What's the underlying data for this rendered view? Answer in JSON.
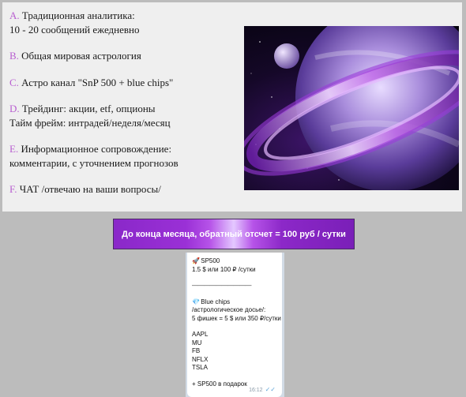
{
  "services": [
    {
      "letter": "A.",
      "lines": [
        "Традиционная аналитика:",
        "10 - 20 сообщений ежедневно"
      ]
    },
    {
      "letter": "B.",
      "lines": [
        "Общая мировая астрология"
      ]
    },
    {
      "letter": "C.",
      "lines": [
        "Астро канал \"SnP 500 + blue chips\""
      ]
    },
    {
      "letter": "D.",
      "lines": [
        "Трейдинг: акции, etf, опционы",
        "Тайм фрейм: интрадей/неделя/месяц"
      ]
    },
    {
      "letter": "E.",
      "lines": [
        "Информационное сопровождение:",
        "комментарии, с уточнением прогнозов"
      ]
    },
    {
      "letter": "F.",
      "lines": [
        "ЧАТ /отвечаю на ваши вопросы/"
      ]
    }
  ],
  "banner": {
    "text": "До конца месяца, обратный отсчет = 100 руб / сутки"
  },
  "chat": {
    "sp500_title": "SP500",
    "sp500_price": "1.5 $ или 100 ₽ /сутки",
    "divider": "——————————",
    "bluechips_title": "Blue chips",
    "bluechips_desc": "/астрологическое досье/:",
    "bluechips_price": "5 фишек = 5 $ или 350 ₽/сутки",
    "tickers": [
      "AAPL",
      "MU",
      "FB",
      "NFLX",
      "TSLA"
    ],
    "bonus": "+ SP500 в подарок",
    "time": "16:12"
  },
  "colors": {
    "letter": "#b85fd0",
    "banner": "#9a30d6",
    "chat_bg": "#d2dbe6"
  },
  "icons": {
    "sp500": "rocket-icon",
    "bluechips": "diamond-icon",
    "status": "double-check-icon"
  }
}
